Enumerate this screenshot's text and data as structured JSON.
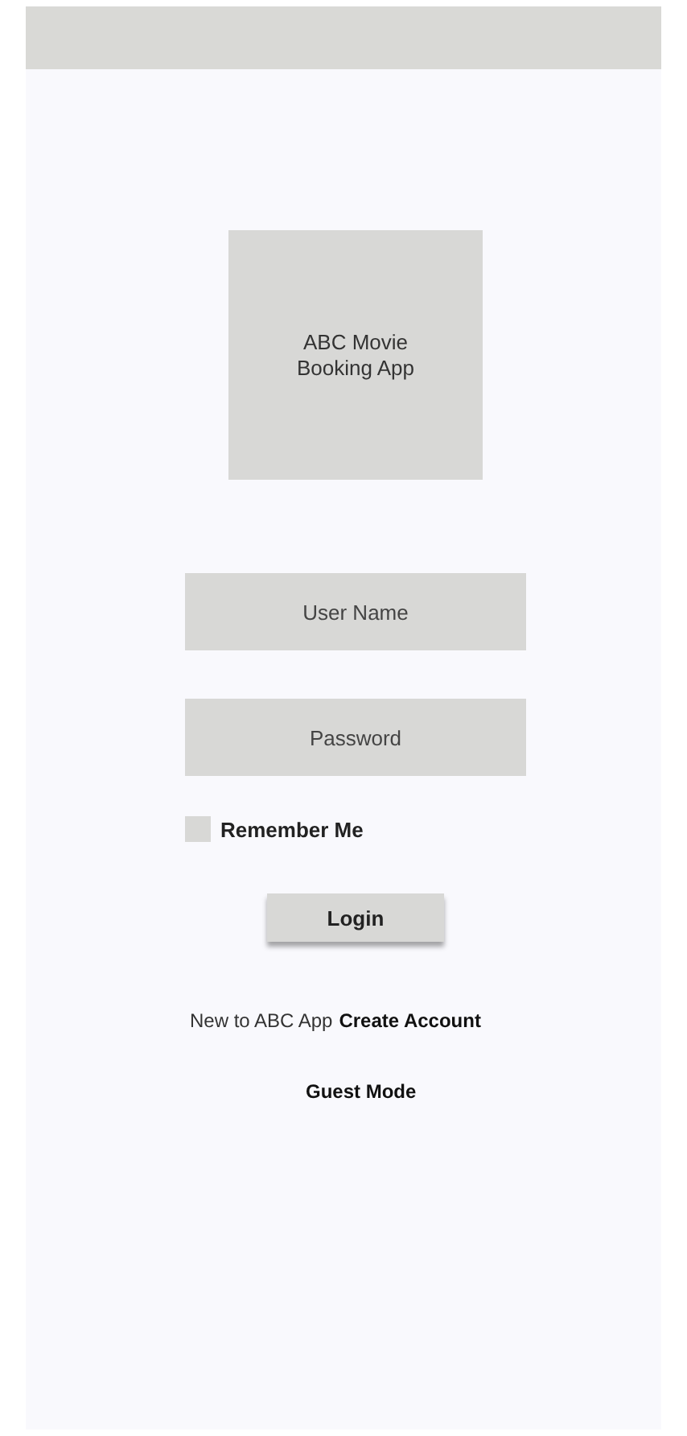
{
  "logo": {
    "text": "ABC Movie Booking App"
  },
  "username": {
    "placeholder": "User Name"
  },
  "password": {
    "placeholder": "Password"
  },
  "remember": {
    "label": "Remember Me",
    "checked": false
  },
  "login_button": {
    "label": "Login"
  },
  "signup": {
    "prompt": "New to ABC App",
    "link": "Create Account"
  },
  "guest_link": {
    "label": "Guest Mode"
  }
}
